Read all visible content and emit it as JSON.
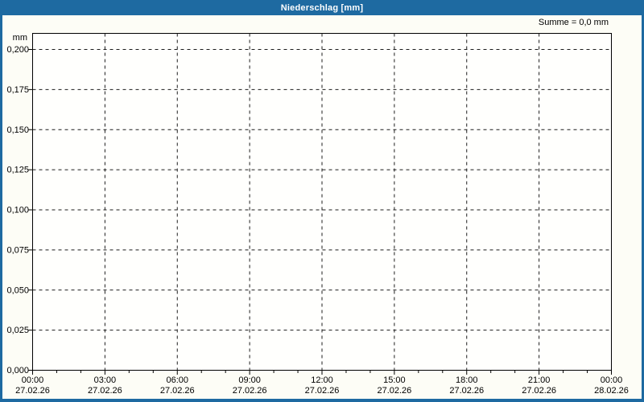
{
  "window": {
    "title": "Niederschlag [mm]",
    "summary": "Summe = 0,0 mm"
  },
  "colors": {
    "frame_blue": "#1e6aa1",
    "title_text": "#ffffff",
    "content_bg": "#fdfdf6",
    "plot_bg": "#fffffd",
    "grid_line": "#1c1c1c",
    "axis_line": "#000000",
    "label_text": "#000000"
  },
  "chart_data": {
    "type": "bar",
    "title": "Niederschlag [mm]",
    "ylabel": "mm",
    "xlabel": "",
    "summary": "Summe = 0,0 mm",
    "values": [],
    "series": [],
    "sum_mm": "0,0",
    "grid": {
      "style": "dashed",
      "horizontal": true,
      "vertical": true
    },
    "x_axis": {
      "start": "27.02.26 00:00",
      "end": "28.02.26 00:00",
      "major_tick_interval_hours": 3,
      "minor_tick_interval_hours": 1,
      "ticks": [
        {
          "time": "00:00",
          "date": "27.02.26"
        },
        {
          "time": "03:00",
          "date": "27.02.26"
        },
        {
          "time": "06:00",
          "date": "27.02.26"
        },
        {
          "time": "09:00",
          "date": "27.02.26"
        },
        {
          "time": "12:00",
          "date": "27.02.26"
        },
        {
          "time": "15:00",
          "date": "27.02.26"
        },
        {
          "time": "18:00",
          "date": "27.02.26"
        },
        {
          "time": "21:00",
          "date": "27.02.26"
        },
        {
          "time": "00:00",
          "date": "28.02.26"
        }
      ]
    },
    "y_axis": {
      "min": 0,
      "max": 0.2,
      "step": 0.025,
      "plotted_max_with_headroom": 0.21,
      "tick_labels": [
        "0,000",
        "0,025",
        "0,050",
        "0,075",
        "0,100",
        "0,125",
        "0,150",
        "0,175",
        "0,200"
      ]
    }
  }
}
